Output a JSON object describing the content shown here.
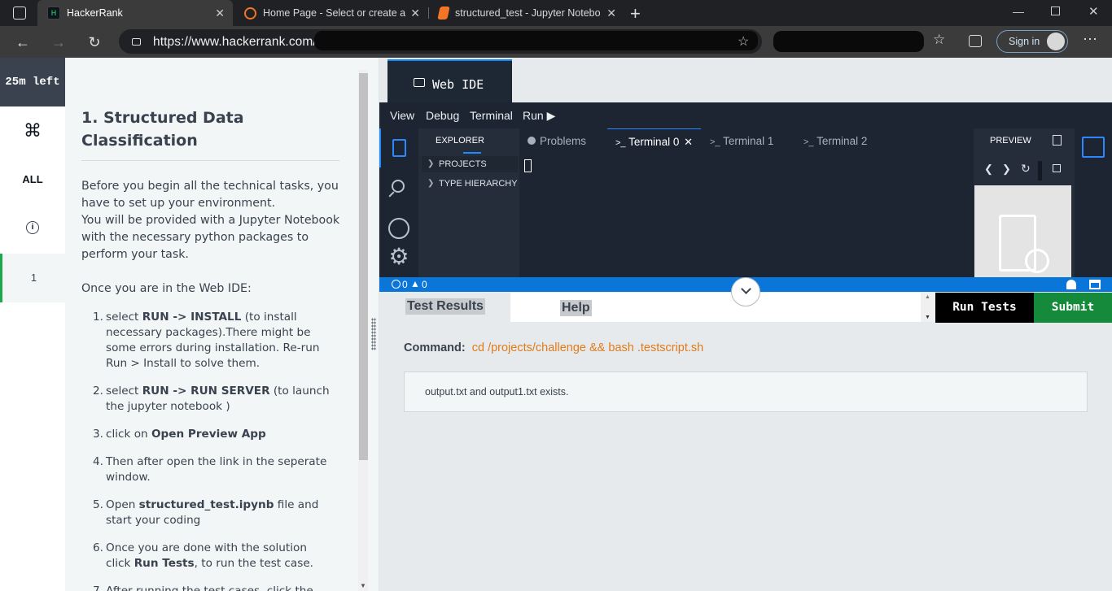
{
  "browser": {
    "tabs": [
      {
        "title": "HackerRank",
        "active": true
      },
      {
        "title": "Home Page - Select or create a n",
        "active": false
      },
      {
        "title": "structured_test - Jupyter Notebo",
        "active": false
      }
    ],
    "url": "https://www.hackerrank.com/",
    "sign_in": "Sign in"
  },
  "rail": {
    "timer": "25m left",
    "shortcuts_glyph": "⌘",
    "all_label": "ALL",
    "info_glyph": "i",
    "question_number": "1"
  },
  "problem": {
    "title": "1. Structured Data Classification",
    "intro_1": "Before you begin all the technical tasks, you have to set up your environment.",
    "intro_2": "You will be provided with a Jupyter Notebook with the necessary python packages to perform your task.",
    "intro_3": "Once you are in the Web IDE:",
    "steps": [
      {
        "num": "1.",
        "pre": "select ",
        "bold": "RUN -> INSTALL",
        "post": " (to install necessary packages).There might be some errors during installation. Re-run Run > Install to solve them."
      },
      {
        "num": "2.",
        "pre": "select ",
        "bold": "RUN -> RUN SERVER",
        "post": " (to launch the jupyter notebook )"
      },
      {
        "num": "3.",
        "pre": "click on  ",
        "bold": "Open Preview App",
        "post": ""
      },
      {
        "num": "4.",
        "pre": "Then after open the link in the seperate window.",
        "bold": "",
        "post": ""
      },
      {
        "num": "5.",
        "pre": "Open ",
        "bold": "structured_test.ipynb",
        "post": " file and  start your coding"
      },
      {
        "num": "6.",
        "pre": "Once you are done with the solution click ",
        "bold": "Run Tests",
        "post": ", to run the test case."
      },
      {
        "num": "7.",
        "pre": "After running the test cases, click the",
        "bold": "",
        "post": ""
      }
    ]
  },
  "ide": {
    "tab_label": "Web IDE",
    "menu": [
      "View",
      "Debug",
      "Terminal",
      "Run ▶"
    ],
    "explorer": {
      "header": "EXPLORER",
      "items": [
        "PROJECTS",
        "TYPE HIERARCHY"
      ]
    },
    "panel_tabs": {
      "problems": "Problems",
      "terminal0": "Terminal 0",
      "terminal1": "Terminal 1",
      "terminal2": "Terminal 2"
    },
    "preview_header": "PREVIEW",
    "status": {
      "errors": "0",
      "warnings": "0"
    }
  },
  "results": {
    "tab_results": "Test Results",
    "tab_help": "Help",
    "run_tests": "Run Tests",
    "submit": "Submit",
    "command_label": "Command:",
    "command_value": "cd /projects/challenge && bash .testscript.sh",
    "output": "output.txt and output1.txt exists."
  },
  "colors": {
    "accent_blue": "#0a76d9",
    "submit_green": "#168a3b",
    "command_orange": "#e07b1a",
    "ide_dark": "#1d2532"
  }
}
